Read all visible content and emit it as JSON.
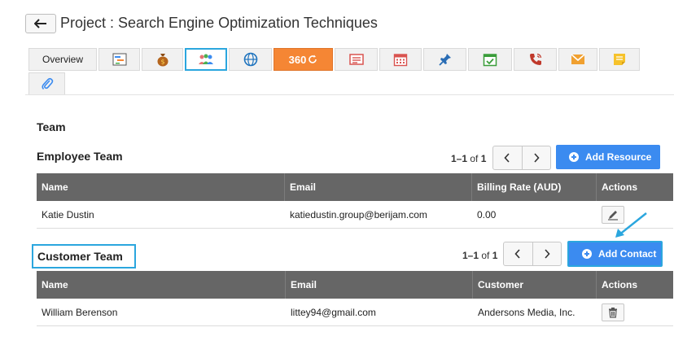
{
  "header": {
    "title": "Project : Search Engine Optimization Techniques"
  },
  "tabs": [
    {
      "id": "overview",
      "label": "Overview",
      "icon": ""
    },
    {
      "id": "gantt",
      "label": "",
      "icon": "gantt-chart-icon"
    },
    {
      "id": "budget",
      "label": "",
      "icon": "money-bag-icon"
    },
    {
      "id": "team",
      "label": "",
      "icon": "team-people-icon",
      "active": true
    },
    {
      "id": "web",
      "label": "",
      "icon": "globe-icon"
    },
    {
      "id": "view360",
      "label": "360",
      "icon": "refresh-icon"
    },
    {
      "id": "invoice",
      "label": "",
      "icon": "invoice-icon"
    },
    {
      "id": "calendar",
      "label": "",
      "icon": "calendar-icon"
    },
    {
      "id": "pin",
      "label": "",
      "icon": "pin-icon"
    },
    {
      "id": "tasks",
      "label": "",
      "icon": "calendar-check-icon"
    },
    {
      "id": "calls",
      "label": "",
      "icon": "phone-icon"
    },
    {
      "id": "email",
      "label": "",
      "icon": "envelope-icon"
    },
    {
      "id": "notes",
      "label": "",
      "icon": "sticky-note-icon"
    },
    {
      "id": "attachments",
      "label": "",
      "icon": "paperclip-icon"
    }
  ],
  "team": {
    "title": "Team",
    "employee": {
      "title": "Employee Team",
      "pager": {
        "range": "1–1",
        "of": "of",
        "total": "1"
      },
      "add_label": "Add Resource",
      "columns": [
        "Name",
        "Email",
        "Billing Rate (AUD)",
        "Actions"
      ],
      "rows": [
        {
          "name": "Katie Dustin",
          "email": "katiedustin.group@berijam.com",
          "rate": "0.00"
        }
      ]
    },
    "customer": {
      "title": "Customer Team",
      "pager": {
        "range": "1–1",
        "of": "of",
        "total": "1"
      },
      "add_label": "Add Contact",
      "columns": [
        "Name",
        "Email",
        "Customer",
        "Actions"
      ],
      "rows": [
        {
          "name": "William Berenson",
          "email": "littey94@gmail.com",
          "customer": "Andersons Media, Inc."
        }
      ]
    }
  },
  "colors": {
    "accent": "#2ba6de",
    "primary_button": "#3b8bf0",
    "table_header": "#666666",
    "tab_360": "#f58634"
  }
}
